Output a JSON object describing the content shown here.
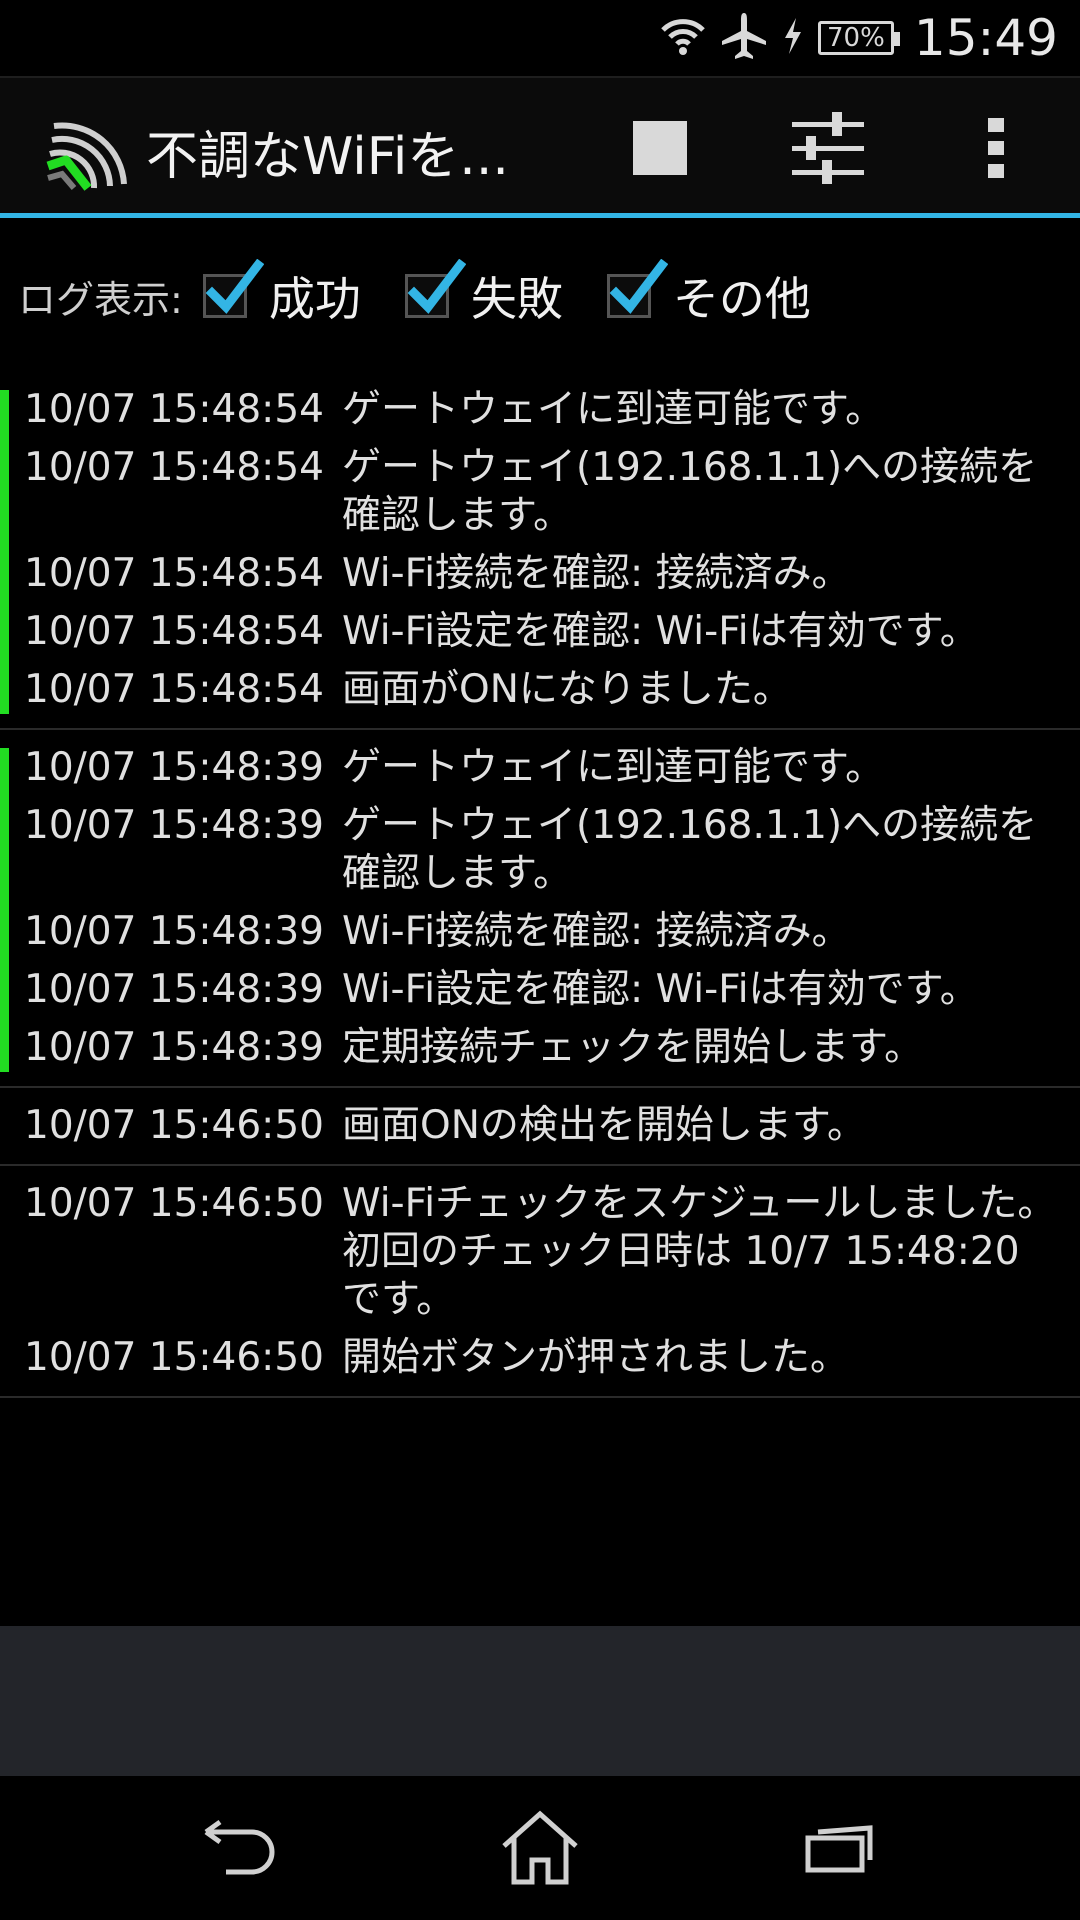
{
  "status_bar": {
    "battery": "70%",
    "time": "15:49",
    "icons": [
      "wifi-icon",
      "airplane-icon",
      "charging-icon",
      "battery-icon"
    ]
  },
  "action_bar": {
    "title": "不調なWiFiを...",
    "icons": [
      "app-logo-icon",
      "stop-icon",
      "settings-sliders-icon",
      "overflow-menu-icon"
    ],
    "accent_color": "#33b5e5"
  },
  "filters": {
    "label": "ログ表示:",
    "options": [
      {
        "label": "成功",
        "checked": true
      },
      {
        "label": "失敗",
        "checked": true
      },
      {
        "label": "その他",
        "checked": true
      }
    ]
  },
  "log_groups": [
    {
      "status": "success",
      "entries": [
        {
          "time": "10/07 15:48:54",
          "message": "ゲートウェイに到達可能です。"
        },
        {
          "time": "10/07 15:48:54",
          "message": "ゲートウェイ(192.168.1.1)への接続を確認します。"
        },
        {
          "time": "10/07 15:48:54",
          "message": "Wi-Fi接続を確認: 接続済み。"
        },
        {
          "time": "10/07 15:48:54",
          "message": "Wi-Fi設定を確認: Wi-Fiは有効です。"
        },
        {
          "time": "10/07 15:48:54",
          "message": "画面がONになりました。"
        }
      ]
    },
    {
      "status": "success",
      "entries": [
        {
          "time": "10/07 15:48:39",
          "message": "ゲートウェイに到達可能です。"
        },
        {
          "time": "10/07 15:48:39",
          "message": "ゲートウェイ(192.168.1.1)への接続を確認します。"
        },
        {
          "time": "10/07 15:48:39",
          "message": "Wi-Fi接続を確認: 接続済み。"
        },
        {
          "time": "10/07 15:48:39",
          "message": "Wi-Fi設定を確認: Wi-Fiは有効です。"
        },
        {
          "time": "10/07 15:48:39",
          "message": "定期接続チェックを開始します。"
        }
      ]
    },
    {
      "status": "other",
      "entries": [
        {
          "time": "10/07 15:46:50",
          "message": "画面ONの検出を開始します。"
        }
      ]
    },
    {
      "status": "other",
      "entries": [
        {
          "time": "10/07 15:46:50",
          "message": "Wi-Fiチェックをスケジュールしました。初回のチェック日時は 10/7 15:48:20 です。"
        },
        {
          "time": "10/07 15:46:50",
          "message": "開始ボタンが押されました。"
        }
      ]
    }
  ],
  "colors": {
    "success_bar": "#22dd22",
    "background": "#000000",
    "panel": "#23252a"
  },
  "nav_bar": {
    "icons": [
      "back-icon",
      "home-icon",
      "recent-apps-icon"
    ]
  }
}
